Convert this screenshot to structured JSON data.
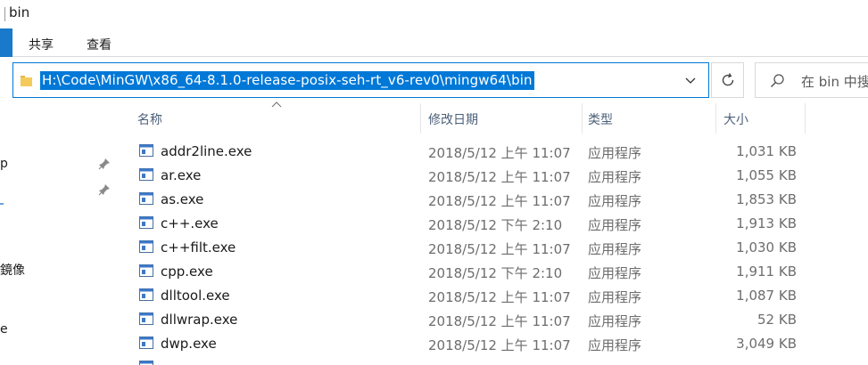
{
  "window": {
    "title": "bin"
  },
  "ribbon": {
    "tabs": [
      "共享",
      "查看"
    ]
  },
  "address": {
    "path": "H:\\Code\\MinGW\\x86_64-8.1.0-release-posix-seh-rt_v6-rev0\\mingw64\\bin"
  },
  "search": {
    "placeholder": "在 bin 中搜"
  },
  "nav": {
    "fragments": [
      "p",
      "鏡像",
      "e"
    ]
  },
  "columns": {
    "name": "名称",
    "date": "修改日期",
    "type": "类型",
    "size": "大小"
  },
  "files": [
    {
      "name": "addr2line.exe",
      "date": "2018/5/12 上午 11:07",
      "type": "应用程序",
      "size": "1,031 KB"
    },
    {
      "name": "ar.exe",
      "date": "2018/5/12 上午 11:07",
      "type": "应用程序",
      "size": "1,055 KB"
    },
    {
      "name": "as.exe",
      "date": "2018/5/12 上午 11:07",
      "type": "应用程序",
      "size": "1,853 KB"
    },
    {
      "name": "c++.exe",
      "date": "2018/5/12 下午 2:10",
      "type": "应用程序",
      "size": "1,913 KB"
    },
    {
      "name": "c++filt.exe",
      "date": "2018/5/12 上午 11:07",
      "type": "应用程序",
      "size": "1,030 KB"
    },
    {
      "name": "cpp.exe",
      "date": "2018/5/12 下午 2:10",
      "type": "应用程序",
      "size": "1,911 KB"
    },
    {
      "name": "dlltool.exe",
      "date": "2018/5/12 上午 11:07",
      "type": "应用程序",
      "size": "1,087 KB"
    },
    {
      "name": "dllwrap.exe",
      "date": "2018/5/12 上午 11:07",
      "type": "应用程序",
      "size": "52 KB"
    },
    {
      "name": "dwp.exe",
      "date": "2018/5/12 上午 11:07",
      "type": "应用程序",
      "size": "3,049 KB"
    }
  ],
  "colors": {
    "accent": "#0078d7",
    "header_text": "#4c607a",
    "secondary_text": "#6d6d6d"
  }
}
